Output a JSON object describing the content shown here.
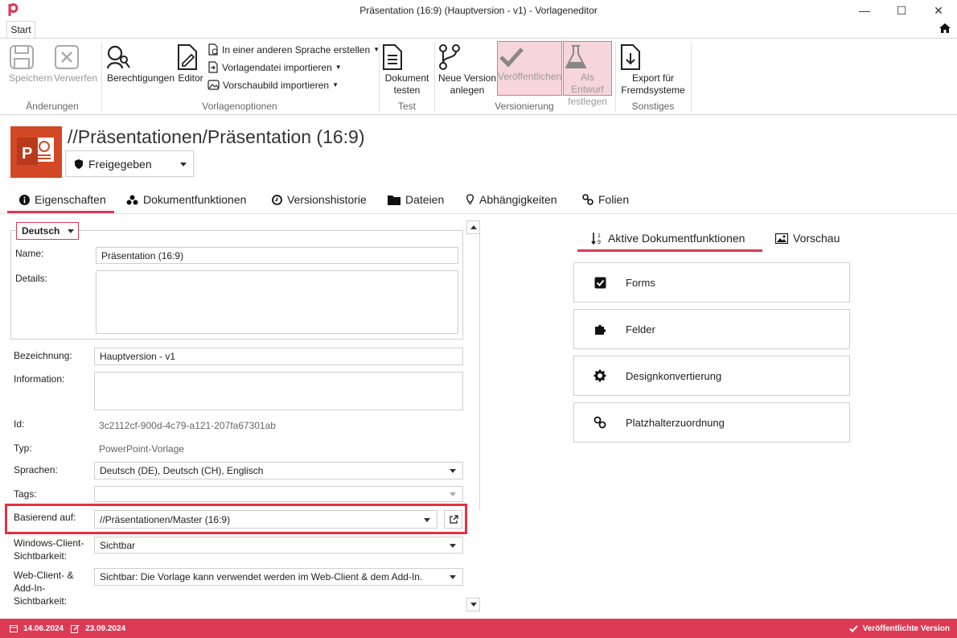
{
  "window": {
    "title": "Präsentation (16:9) (Hauptversion - v1) - Vorlageneditor",
    "minimize": "—",
    "maximize": "☐",
    "close": "✕"
  },
  "ribbon": {
    "tab_start": "Start",
    "save": "Speichern",
    "discard": "Verwerfen",
    "group_changes": "Änderungen",
    "permissions": "Berechtigungen",
    "editor": "Editor",
    "create_other_language": "In einer anderen Sprache erstellen",
    "import_template_file": "Vorlagendatei importieren",
    "import_preview": "Vorschaubild importieren",
    "group_template_options": "Vorlagenoptionen",
    "test_doc_1": "Dokument",
    "test_doc_2": "testen",
    "group_test": "Test",
    "new_version_1": "Neue Version",
    "new_version_2": "anlegen",
    "publish": "Veröffentlichen",
    "draft_1": "Als Entwurf",
    "draft_2": "festlegen",
    "group_versioning": "Versionierung",
    "export_1": "Export für",
    "export_2": "Fremdsysteme",
    "group_misc": "Sonstiges"
  },
  "header": {
    "path": "//Präsentationen/Präsentation (16:9)",
    "status": "Freigegeben"
  },
  "tabs": [
    "Eigenschaften",
    "Dokumentfunktionen",
    "Versionshistorie",
    "Dateien",
    "Abhängigkeiten",
    "Folien"
  ],
  "form": {
    "language": "Deutsch",
    "name_label": "Name:",
    "name_value": "Präsentation (16:9)",
    "details_label": "Details:",
    "designation_label": "Bezeichnung:",
    "designation_value": "Hauptversion - v1",
    "information_label": "Information:",
    "id_label": "Id:",
    "id_value": "3c2112cf-900d-4c79-a121-207fa67301ab",
    "type_label": "Typ:",
    "type_value": "PowerPoint-Vorlage",
    "languages_label": "Sprachen:",
    "languages_value": "Deutsch (DE), Deutsch (CH), Englisch",
    "tags_label": "Tags:",
    "based_on_label": "Basierend auf:",
    "based_on_value": "//Präsentationen/Master (16:9)",
    "windows_vis_label_1": "Windows-Client-",
    "windows_vis_label_2": "Sichtbarkeit:",
    "windows_vis_value": "Sichtbar",
    "web_vis_label_1": "Web-Client- &",
    "web_vis_label_2": "Add-In-",
    "web_vis_label_3": "Sichtbarkeit:",
    "web_vis_value": "Sichtbar: Die Vorlage kann verwendet werden im Web-Client & dem Add-In."
  },
  "right": {
    "tab_active": "Aktive Dokumentfunktionen",
    "tab_preview": "Vorschau",
    "cards": [
      "Forms",
      "Felder",
      "Designkonvertierung",
      "Platzhalterzuordnung"
    ]
  },
  "statusbar": {
    "created": "14.06.2024",
    "modified": "23.09.2024",
    "state": "Veröffentlichte Version"
  },
  "colors": {
    "accent": "#dc3a55",
    "publish_bg": "#f6d5db",
    "ppt_orange": "#d24726"
  }
}
